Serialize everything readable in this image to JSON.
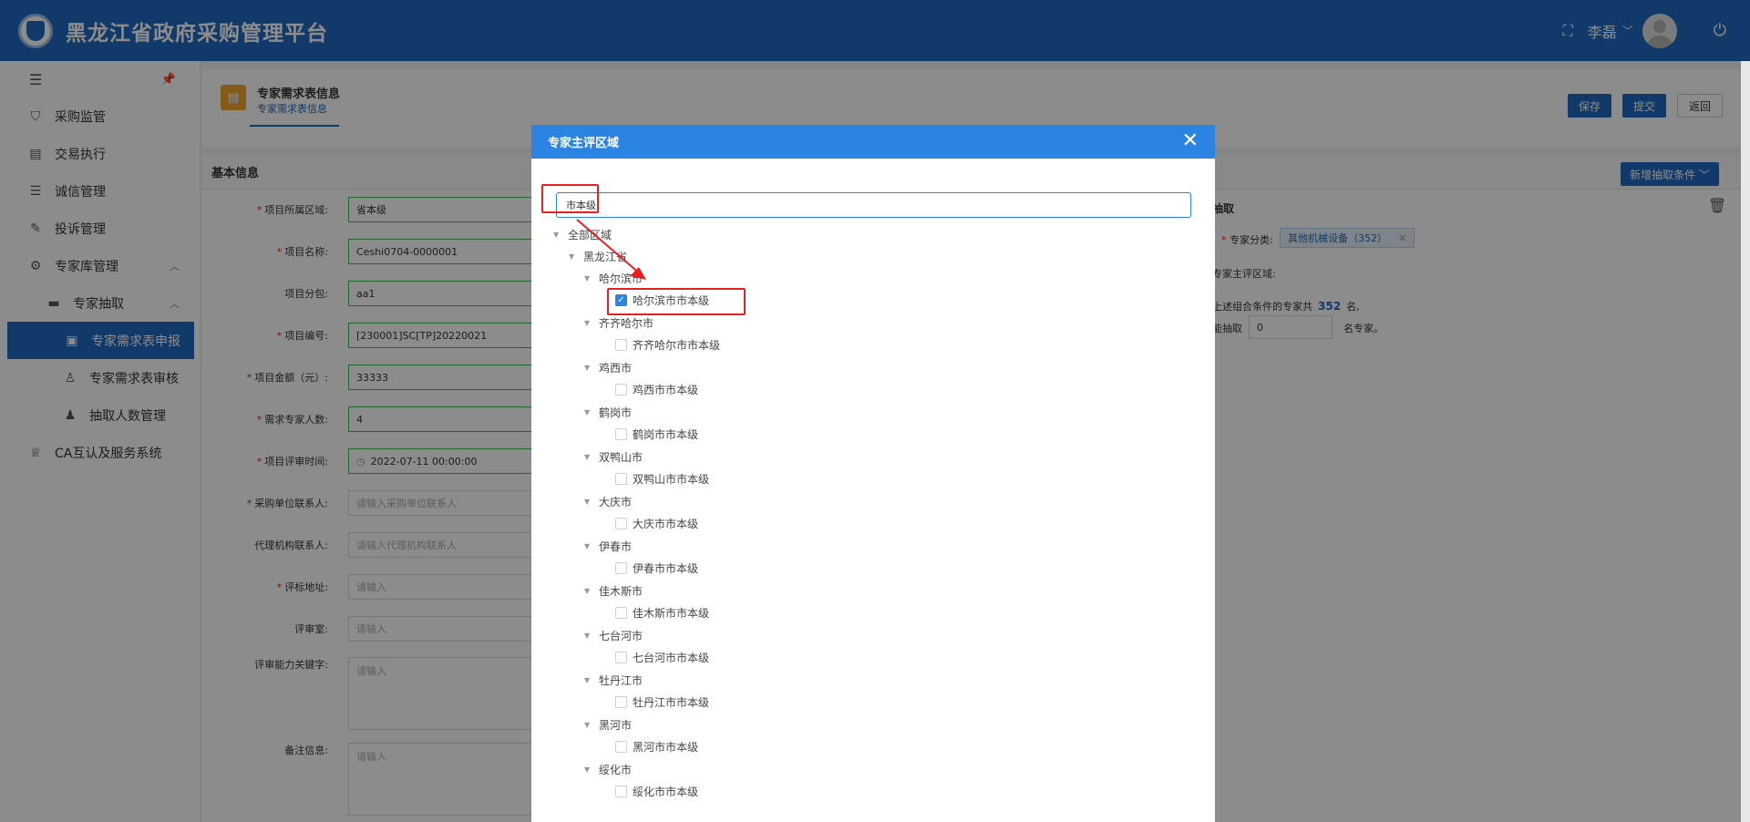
{
  "app": {
    "title": "黑龙江省政府采购管理平台",
    "user": "李磊"
  },
  "sidebar": {
    "items": [
      {
        "label": "采购监管",
        "icon": "shield-icon"
      },
      {
        "label": "交易执行",
        "icon": "clipboard-icon"
      },
      {
        "label": "诚信管理",
        "icon": "list-icon"
      },
      {
        "label": "投诉管理",
        "icon": "doc-edit-icon"
      },
      {
        "label": "专家库管理",
        "icon": "gear-icon"
      },
      {
        "label": "专家抽取",
        "icon": "monitor-icon"
      },
      {
        "label": "专家需求表申报",
        "icon": "form-icon"
      },
      {
        "label": "专家需求表审核",
        "icon": "user-check-icon"
      },
      {
        "label": "抽取人数管理",
        "icon": "users-icon"
      },
      {
        "label": "CA互认及服务系统",
        "icon": "badge-icon"
      }
    ]
  },
  "page": {
    "title": "专家需求表信息",
    "tab": "专家需求表信息",
    "buttons": {
      "save": "保存",
      "submit": "提交",
      "back": "返回"
    },
    "panel_title": "基本信息",
    "add_condition": "新增抽取条件"
  },
  "form": [
    {
      "label": "项目所属区域:",
      "required": true,
      "value": "省本级"
    },
    {
      "label": "项目名称:",
      "required": true,
      "value": "Ceshi0704-0000001"
    },
    {
      "label": "项目分包:",
      "required": false,
      "value": "aa1"
    },
    {
      "label": "项目编号:",
      "required": true,
      "value": "[230001]SC[TP]20220021"
    },
    {
      "label": "项目金额（元）:",
      "required": true,
      "value": "33333"
    },
    {
      "label": "需求专家人数:",
      "required": true,
      "value": "4"
    },
    {
      "label": "项目评审时间:",
      "required": true,
      "value": "2022-07-11 00:00:00"
    },
    {
      "label": "采购单位联系人:",
      "required": true,
      "placeholder": "请输入采购单位联系人"
    },
    {
      "label": "代理机构联系人:",
      "required": false,
      "placeholder": "请输入代理机构联系人"
    },
    {
      "label": "评标地址:",
      "required": true,
      "placeholder": "请输入"
    },
    {
      "label": "评审室:",
      "required": false,
      "placeholder": "请输入"
    },
    {
      "label": "评审能力关键字:",
      "required": false,
      "placeholder": "请输入"
    },
    {
      "label": "备注信息:",
      "required": false,
      "placeholder": "请输入"
    }
  ],
  "extract": {
    "title": "抽取",
    "category_label": "专家分类:",
    "category_tag": "其他机械设备（352）",
    "region_label": "专家主评区域:",
    "summary_prefix": "上述组合条件的专家共",
    "summary_count": "352",
    "summary_suffix": "名,",
    "extract_prefix": "能抽取",
    "extract_value": "0",
    "extract_suffix": "名专家。"
  },
  "modal": {
    "title": "专家主评区域",
    "search_value": "市本级",
    "tree": {
      "root": "全部区域",
      "province": "黑龙江省",
      "cities": [
        {
          "name": "哈尔滨市",
          "child": "哈尔滨市市本级",
          "checked": true
        },
        {
          "name": "齐齐哈尔市",
          "child": "齐齐哈尔市市本级",
          "checked": false
        },
        {
          "name": "鸡西市",
          "child": "鸡西市市本级",
          "checked": false
        },
        {
          "name": "鹤岗市",
          "child": "鹤岗市市本级",
          "checked": false
        },
        {
          "name": "双鸭山市",
          "child": "双鸭山市市本级",
          "checked": false
        },
        {
          "name": "大庆市",
          "child": "大庆市市本级",
          "checked": false
        },
        {
          "name": "伊春市",
          "child": "伊春市市本级",
          "checked": false
        },
        {
          "name": "佳木斯市",
          "child": "佳木斯市市本级",
          "checked": false
        },
        {
          "name": "七台河市",
          "child": "七台河市市本级",
          "checked": false
        },
        {
          "name": "牡丹江市",
          "child": "牡丹江市市本级",
          "checked": false
        },
        {
          "name": "黑河市",
          "child": "黑河市市本级",
          "checked": false
        },
        {
          "name": "绥化市",
          "child": "绥化市市本级",
          "checked": false
        }
      ]
    }
  }
}
